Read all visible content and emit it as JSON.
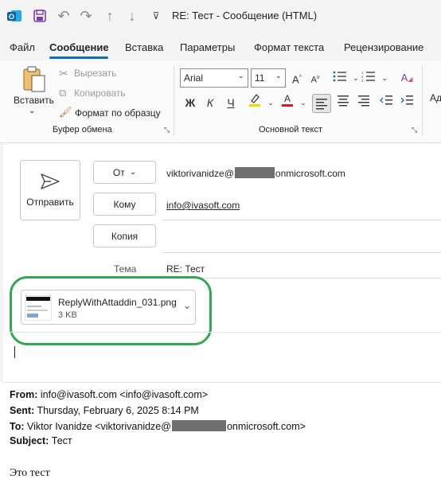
{
  "window": {
    "title": "RE: Тест  -  Сообщение (HTML)"
  },
  "quick_access": {
    "icons": [
      "outlook-icon",
      "save-icon",
      "undo-icon",
      "redo-icon",
      "up-icon",
      "down-icon",
      "customize-icon"
    ]
  },
  "menu": {
    "items": [
      "Файл",
      "Сообщение",
      "Вставка",
      "Параметры",
      "Формат текста",
      "Рецензирование"
    ],
    "active": "Сообщение"
  },
  "ribbon": {
    "clipboard": {
      "paste": "Вставить",
      "cut": "Вырезать",
      "copy": "Копировать",
      "format_painter": "Формат по образцу",
      "group": "Буфер обмена"
    },
    "basic_text": {
      "font": "Arial",
      "size": "11",
      "bold": "Ж",
      "italic": "К",
      "underline": "Ч",
      "group": "Основной текст",
      "overflow": "Ад"
    }
  },
  "compose": {
    "send": "Отправить",
    "from_button": "От",
    "to_button": "Кому",
    "cc_button": "Копия",
    "from_before": "viktorivanidze@",
    "from_after": "onmicrosoft.com",
    "to": "info@ivasoft.com",
    "subject_label": "Тема",
    "subject": "RE: Тест"
  },
  "attachment": {
    "name": "ReplyWithAttaddin_031.png",
    "size": "3 KB"
  },
  "message": {
    "from_label": "From:",
    "from": "info@ivasoft.com <info@ivasoft.com>",
    "sent_label": "Sent:",
    "sent": "Thursday, February 6, 2025 8:14 PM",
    "to_label": "To:",
    "to_before": "Viktor Ivanidze <viktorivanidze@",
    "to_after": "onmicrosoft.com>",
    "subject_label": "Subject:",
    "subject": "Тест",
    "body": "Это тест"
  },
  "colors": {
    "accent": "#0f6cbd",
    "highlight_callout": "#2fa84f",
    "highlight_yellow": "#f5d400",
    "font_red": "#e81123"
  }
}
